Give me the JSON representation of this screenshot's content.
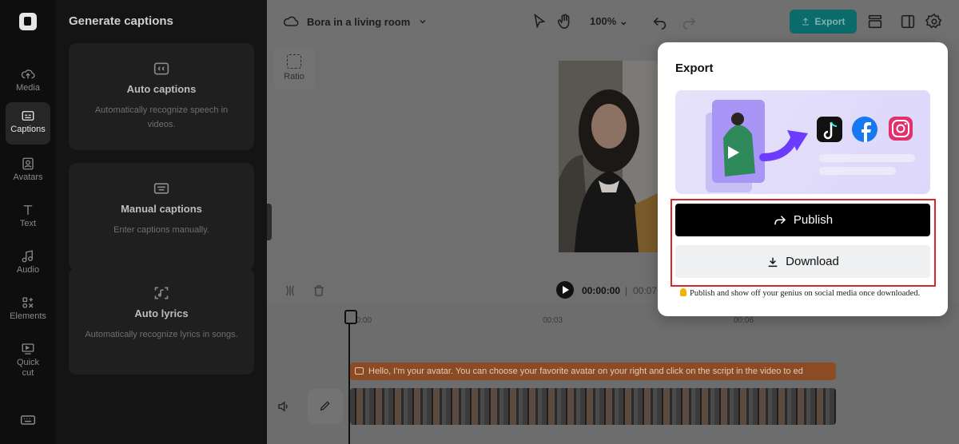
{
  "rail": {
    "items": [
      {
        "label": "Media",
        "icon": "cloud-upload-icon"
      },
      {
        "label": "Captions",
        "icon": "captions-icon"
      },
      {
        "label": "Avatars",
        "icon": "avatar-icon"
      },
      {
        "label": "Text",
        "icon": "text-icon"
      },
      {
        "label": "Audio",
        "icon": "music-note-icon"
      },
      {
        "label": "Elements",
        "icon": "elements-icon"
      },
      {
        "label": "Quick",
        "label2": "cut",
        "icon": "quick-cut-icon"
      }
    ],
    "active": "Captions"
  },
  "panel": {
    "title": "Generate captions",
    "cards": [
      {
        "title": "Auto captions",
        "desc": "Automatically recognize speech in videos.",
        "icon": "cc-icon"
      },
      {
        "title": "Manual captions",
        "desc": "Enter captions manually.",
        "icon": "keyboard-icon"
      },
      {
        "title": "Auto lyrics",
        "desc": "Automatically recognize lyrics in songs.",
        "icon": "music-scan-icon"
      }
    ]
  },
  "topbar": {
    "project_name": "Bora in a living room",
    "zoom": "100%",
    "export_label": "Export"
  },
  "canvas": {
    "ratio_label": "Ratio"
  },
  "player": {
    "current_time": "00:00:00",
    "separator": "|",
    "total_time": "00:07"
  },
  "timeline": {
    "ticks": [
      "00:00",
      "00:03",
      "00:06"
    ],
    "caption_text": "Hello, I'm your avatar. You can choose your favorite avatar on your right and click on the script in the video to ed"
  },
  "export_modal": {
    "title": "Export",
    "publish_label": "Publish",
    "download_label": "Download",
    "tip": "Publish and show off your genius on social media once downloaded."
  },
  "colors": {
    "accent_teal": "#0b6b6a",
    "highlight_red": "#d9262c",
    "caption_orange": "#8b4b24",
    "banner_purple": "#7c4dff"
  }
}
